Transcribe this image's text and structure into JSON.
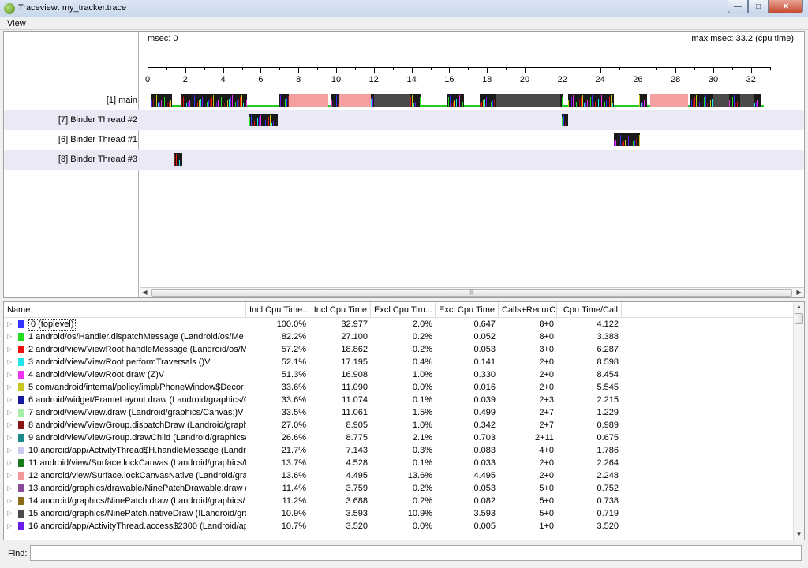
{
  "window": {
    "title": "Traceview: my_tracker.trace"
  },
  "menu": {
    "view_label": "View"
  },
  "timeline": {
    "msec_start": "msec: 0",
    "msec_max": "max msec: 33.2 (cpu time)",
    "ticks": [
      "0",
      "2",
      "4",
      "6",
      "8",
      "10",
      "12",
      "14",
      "16",
      "18",
      "20",
      "22",
      "24",
      "26",
      "28",
      "30",
      "32"
    ],
    "threads": [
      {
        "label": "[1] main"
      },
      {
        "label": "[7] Binder Thread #2"
      },
      {
        "label": "[6] Binder Thread #1"
      },
      {
        "label": "[8] Binder Thread #3"
      }
    ],
    "scroll_thumb": "|||"
  },
  "table": {
    "columns": [
      "Name",
      "Incl Cpu Time...",
      "Incl Cpu Time",
      "Excl Cpu Tim...",
      "Excl Cpu Time",
      "Calls+RecurC...",
      "Cpu Time/Call"
    ],
    "rows": [
      {
        "color": "#3333ff",
        "name": "0 (toplevel)",
        "incl_pct": "100.0%",
        "incl": "32.977",
        "excl_pct": "2.0%",
        "excl": "0.647",
        "calls": "8+0",
        "per_call": "4.122"
      },
      {
        "color": "#22dd22",
        "name": "1 android/os/Handler.dispatchMessage (Landroid/os/Me",
        "incl_pct": "82.2%",
        "incl": "27.100",
        "excl_pct": "0.2%",
        "excl": "0.052",
        "calls": "8+0",
        "per_call": "3.388"
      },
      {
        "color": "#ee1111",
        "name": "2 android/view/ViewRoot.handleMessage (Landroid/os/M",
        "incl_pct": "57.2%",
        "incl": "18.862",
        "excl_pct": "0.2%",
        "excl": "0.053",
        "calls": "3+0",
        "per_call": "6.287"
      },
      {
        "color": "#22e5e5",
        "name": "3 android/view/ViewRoot.performTraversals ()V",
        "incl_pct": "52.1%",
        "incl": "17.195",
        "excl_pct": "0.4%",
        "excl": "0.141",
        "calls": "2+0",
        "per_call": "8.598"
      },
      {
        "color": "#ee33ee",
        "name": "4 android/view/ViewRoot.draw (Z)V",
        "incl_pct": "51.3%",
        "incl": "16.908",
        "excl_pct": "1.0%",
        "excl": "0.330",
        "calls": "2+0",
        "per_call": "8.454"
      },
      {
        "color": "#c8c822",
        "name": "5 com/android/internal/policy/impl/PhoneWindow$Decor",
        "incl_pct": "33.6%",
        "incl": "11.090",
        "excl_pct": "0.0%",
        "excl": "0.016",
        "calls": "2+0",
        "per_call": "5.545"
      },
      {
        "color": "#1a1aa0",
        "name": "6 android/widget/FrameLayout.draw (Landroid/graphics/C",
        "incl_pct": "33.6%",
        "incl": "11.074",
        "excl_pct": "0.1%",
        "excl": "0.039",
        "calls": "2+3",
        "per_call": "2.215"
      },
      {
        "color": "#a8eea8",
        "name": "7 android/view/View.draw (Landroid/graphics/Canvas;)V",
        "incl_pct": "33.5%",
        "incl": "11.061",
        "excl_pct": "1.5%",
        "excl": "0.499",
        "calls": "2+7",
        "per_call": "1.229"
      },
      {
        "color": "#8a1515",
        "name": "8 android/view/ViewGroup.dispatchDraw (Landroid/graph",
        "incl_pct": "27.0%",
        "incl": "8.905",
        "excl_pct": "1.0%",
        "excl": "0.342",
        "calls": "2+7",
        "per_call": "0.989"
      },
      {
        "color": "#1a8a8a",
        "name": "9 android/view/ViewGroup.drawChild (Landroid/graphics/",
        "incl_pct": "26.6%",
        "incl": "8.775",
        "excl_pct": "2.1%",
        "excl": "0.703",
        "calls": "2+11",
        "per_call": "0.675"
      },
      {
        "color": "#ccccee",
        "name": "10 android/app/ActivityThread$H.handleMessage (Landro",
        "incl_pct": "21.7%",
        "incl": "7.143",
        "excl_pct": "0.3%",
        "excl": "0.083",
        "calls": "4+0",
        "per_call": "1.786"
      },
      {
        "color": "#1a7a1a",
        "name": "11 android/view/Surface.lockCanvas (Landroid/graphics/F",
        "incl_pct": "13.7%",
        "incl": "4.528",
        "excl_pct": "0.1%",
        "excl": "0.033",
        "calls": "2+0",
        "per_call": "2.264"
      },
      {
        "color": "#f29999",
        "name": "12 android/view/Surface.lockCanvasNative (Landroid/grap",
        "incl_pct": "13.6%",
        "incl": "4.495",
        "excl_pct": "13.6%",
        "excl": "4.495",
        "calls": "2+0",
        "per_call": "2.248"
      },
      {
        "color": "#8a4a9a",
        "name": "13 android/graphics/drawable/NinePatchDrawable.draw (",
        "incl_pct": "11.4%",
        "incl": "3.759",
        "excl_pct": "0.2%",
        "excl": "0.053",
        "calls": "5+0",
        "per_call": "0.752"
      },
      {
        "color": "#8a6a1a",
        "name": "14 android/graphics/NinePatch.draw (Landroid/graphics/",
        "incl_pct": "11.2%",
        "incl": "3.688",
        "excl_pct": "0.2%",
        "excl": "0.082",
        "calls": "5+0",
        "per_call": "0.738"
      },
      {
        "color": "#4a4a4a",
        "name": "15 android/graphics/NinePatch.nativeDraw (ILandroid/gra",
        "incl_pct": "10.9%",
        "incl": "3.593",
        "excl_pct": "10.9%",
        "excl": "3.593",
        "calls": "5+0",
        "per_call": "0.719"
      },
      {
        "color": "#6a1aee",
        "name": "16 android/app/ActivityThread.access$2300 (Landroid/ap",
        "incl_pct": "10.7%",
        "incl": "3.520",
        "excl_pct": "0.0%",
        "excl": "0.005",
        "calls": "1+0",
        "per_call": "3.520"
      }
    ]
  },
  "find": {
    "label": "Find:",
    "value": ""
  },
  "colors": {
    "main_pink": "#f4a0a0",
    "main_dark": "#4a4a4a",
    "main_green": "#22cc22",
    "selection_blue": "#eaeaf6"
  }
}
